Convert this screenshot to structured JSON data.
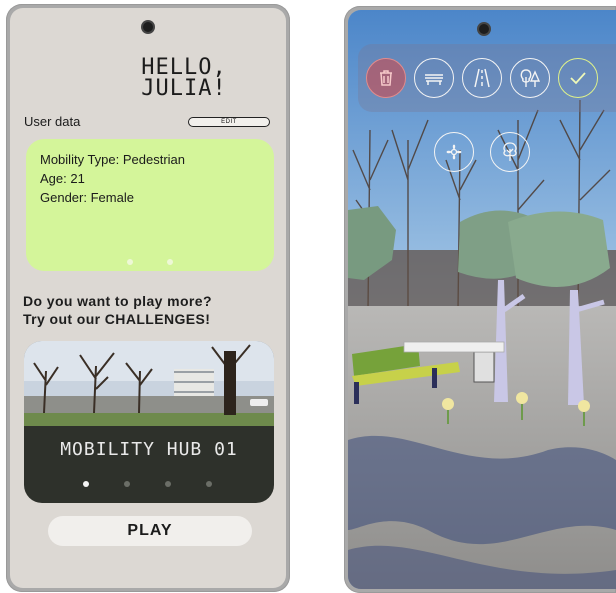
{
  "left_screen": {
    "greeting_line1": "HELLO,",
    "greeting_line2": "JULIA!",
    "user_data_label": "User data",
    "edit_label": "EDIT",
    "user_card": {
      "mobility": "Mobility Type: Pedestrian",
      "age": "Age: 21",
      "gender": "Gender: Female"
    },
    "promo_line1": "Do you want to play more?",
    "promo_line2": "Try out our CHALLENGES!",
    "challenge_title": "MOBILITY HUB 01",
    "play_label": "PLAY"
  },
  "right_screen": {
    "tools_row1": [
      "trash-can-icon",
      "bench-icon",
      "road-icon",
      "trees-icon",
      "checkmark-icon"
    ],
    "tools_row2": [
      "flower-icon",
      "tree-icon"
    ]
  },
  "colors": {
    "screen_bg": "#dcd8d3",
    "card_green": "#d4f59a",
    "challenge_dark": "#2e312b",
    "trash_red": "#d64646",
    "check_lime": "#dff28a"
  }
}
